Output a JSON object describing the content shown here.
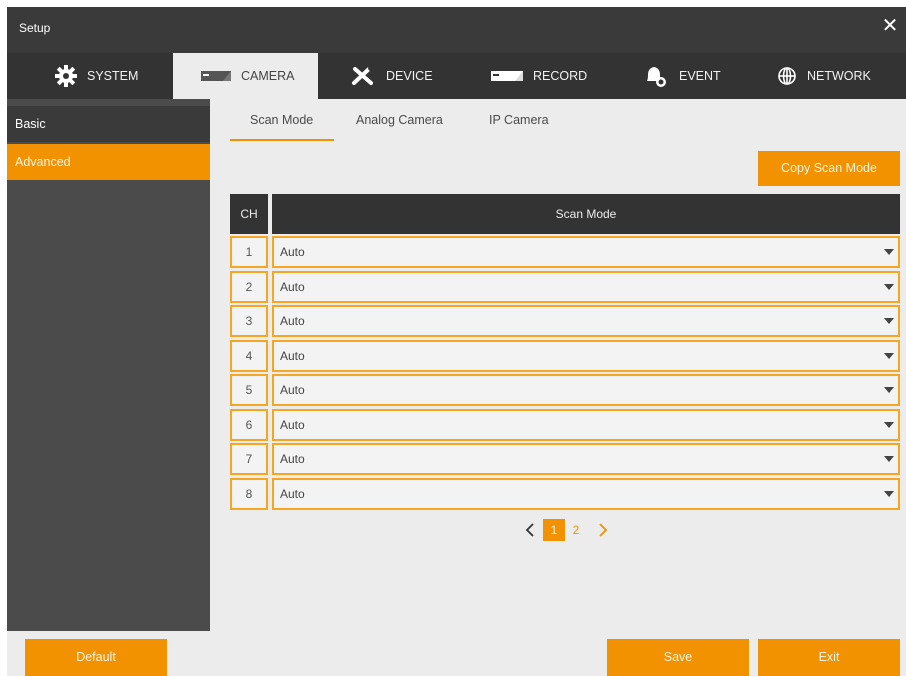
{
  "window": {
    "title": "Setup"
  },
  "tabs": [
    {
      "label": "SYSTEM",
      "icon": "gear-icon"
    },
    {
      "label": "CAMERA",
      "icon": "camera-icon"
    },
    {
      "label": "DEVICE",
      "icon": "tools-icon"
    },
    {
      "label": "RECORD",
      "icon": "record-icon"
    },
    {
      "label": "EVENT",
      "icon": "bell-icon"
    },
    {
      "label": "NETWORK",
      "icon": "globe-icon"
    }
  ],
  "active_tab": "CAMERA",
  "sidebar": {
    "items": [
      {
        "label": "Basic"
      },
      {
        "label": "Advanced"
      }
    ],
    "active": "Advanced"
  },
  "subtabs": [
    {
      "label": "Scan Mode"
    },
    {
      "label": "Analog Camera"
    },
    {
      "label": "IP Camera"
    }
  ],
  "active_subtab": "Scan Mode",
  "copy_button": "Copy Scan Mode",
  "table": {
    "headers": {
      "ch": "CH",
      "mode": "Scan Mode"
    },
    "rows": [
      {
        "ch": "1",
        "mode": "Auto"
      },
      {
        "ch": "2",
        "mode": "Auto"
      },
      {
        "ch": "3",
        "mode": "Auto"
      },
      {
        "ch": "4",
        "mode": "Auto"
      },
      {
        "ch": "5",
        "mode": "Auto"
      },
      {
        "ch": "6",
        "mode": "Auto"
      },
      {
        "ch": "7",
        "mode": "Auto"
      },
      {
        "ch": "8",
        "mode": "Auto"
      }
    ]
  },
  "pagination": {
    "pages": [
      "1",
      "2"
    ],
    "current": "1"
  },
  "footer": {
    "default": "Default",
    "save": "Save",
    "exit": "Exit"
  },
  "colors": {
    "accent": "#f39200",
    "dark": "#333333",
    "panel": "#ececec"
  }
}
